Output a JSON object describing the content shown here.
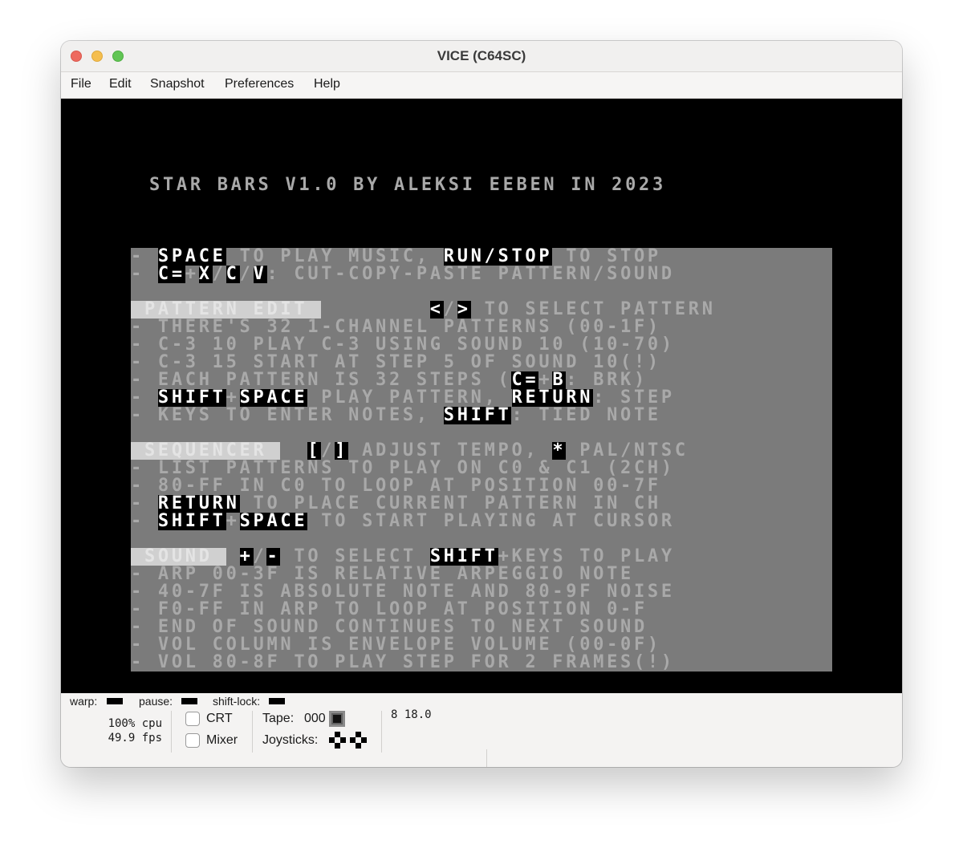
{
  "window": {
    "title": "VICE (C64SC)",
    "traffic_lights": [
      "close",
      "minimize",
      "zoom"
    ]
  },
  "menubar": {
    "items": [
      "File",
      "Edit",
      "Snapshot",
      "Preferences",
      "Help"
    ]
  },
  "c64_screen": {
    "title_line": "STAR BARS V1.0 BY ALEKSI EEBEN IN 2023",
    "lines": [
      [
        {
          "t": "- "
        },
        {
          "t": "SPACE",
          "s": "rv"
        },
        {
          "t": " TO PLAY MUSIC, "
        },
        {
          "t": "RUN/STOP",
          "s": "rv"
        },
        {
          "t": " TO STOP"
        }
      ],
      [
        {
          "t": "- "
        },
        {
          "t": "C=",
          "s": "rv"
        },
        {
          "t": "+"
        },
        {
          "t": "X",
          "s": "rv"
        },
        {
          "t": "/"
        },
        {
          "t": "C",
          "s": "rv"
        },
        {
          "t": "/"
        },
        {
          "t": "V",
          "s": "rv"
        },
        {
          "t": ": CUT-COPY-PASTE PATTERN/SOUND"
        }
      ],
      [
        {
          "t": ""
        }
      ],
      [
        {
          "t": " PATTERN EDIT ",
          "s": "hl"
        },
        {
          "t": "        "
        },
        {
          "t": "<",
          "s": "rv"
        },
        {
          "t": "/"
        },
        {
          "t": ">",
          "s": "rv"
        },
        {
          "t": " TO SELECT PATTERN"
        }
      ],
      [
        {
          "t": "- THERE'S 32 1-CHANNEL PATTERNS (00-1F)"
        }
      ],
      [
        {
          "t": "- C-3 10 PLAY C-3 USING SOUND 10 (10-70)"
        }
      ],
      [
        {
          "t": "- C-3 15 START AT STEP 5 OF SOUND 10(!)"
        }
      ],
      [
        {
          "t": "- EACH PATTERN IS 32 STEPS ("
        },
        {
          "t": "C=",
          "s": "rv"
        },
        {
          "t": "+"
        },
        {
          "t": "B",
          "s": "rv"
        },
        {
          "t": ": BRK)"
        }
      ],
      [
        {
          "t": "- "
        },
        {
          "t": "SHIFT",
          "s": "rv"
        },
        {
          "t": "+"
        },
        {
          "t": "SPACE",
          "s": "rv"
        },
        {
          "t": " PLAY PATTERN, "
        },
        {
          "t": "RETURN",
          "s": "rv"
        },
        {
          "t": ": STEP"
        }
      ],
      [
        {
          "t": "- KEYS TO ENTER NOTES, "
        },
        {
          "t": "SHIFT",
          "s": "rv"
        },
        {
          "t": ": TIED NOTE"
        }
      ],
      [
        {
          "t": ""
        }
      ],
      [
        {
          "t": " SEQUENCER ",
          "s": "hl"
        },
        {
          "t": "  "
        },
        {
          "t": "[",
          "s": "rv"
        },
        {
          "t": "/"
        },
        {
          "t": "]",
          "s": "rv"
        },
        {
          "t": " ADJUST TEMPO, "
        },
        {
          "t": "*",
          "s": "rv"
        },
        {
          "t": " PAL/NTSC"
        }
      ],
      [
        {
          "t": "- LIST PATTERNS TO PLAY ON C0 & C1 (2CH)"
        }
      ],
      [
        {
          "t": "- 80-FF IN C0 TO LOOP AT POSITION 00-7F"
        }
      ],
      [
        {
          "t": "- "
        },
        {
          "t": "RETURN",
          "s": "rv"
        },
        {
          "t": " TO PLACE CURRENT PATTERN IN CH"
        }
      ],
      [
        {
          "t": "- "
        },
        {
          "t": "SHIFT",
          "s": "rv"
        },
        {
          "t": "+"
        },
        {
          "t": "SPACE",
          "s": "rv"
        },
        {
          "t": " TO START PLAYING AT CURSOR"
        }
      ],
      [
        {
          "t": ""
        }
      ],
      [
        {
          "t": " SOUND ",
          "s": "hl"
        },
        {
          "t": " "
        },
        {
          "t": "+",
          "s": "rv"
        },
        {
          "t": "/"
        },
        {
          "t": "-",
          "s": "rv"
        },
        {
          "t": " TO SELECT "
        },
        {
          "t": "SHIFT",
          "s": "rv"
        },
        {
          "t": "+KEYS TO PLAY"
        }
      ],
      [
        {
          "t": "- ARP 00-3F IS RELATIVE ARPEGGIO NOTE"
        }
      ],
      [
        {
          "t": "- 40-7F IS ABSOLUTE NOTE AND 80-9F NOISE"
        }
      ],
      [
        {
          "t": "- F0-FF IN ARP TO LOOP AT POSITION 0-F"
        }
      ],
      [
        {
          "t": "- END OF SOUND CONTINUES TO NEXT SOUND"
        }
      ],
      [
        {
          "t": "- VOL COLUMN IS ENVELOPE VOLUME (00-0F)"
        }
      ],
      [
        {
          "t": "- VOL 80-8F TO PLAY STEP FOR 2 FRAMES(!)"
        }
      ]
    ]
  },
  "statusbar": {
    "warp_label": "warp:",
    "pause_label": "pause:",
    "shiftlock_label": "shift-lock:",
    "cpu": "100% cpu",
    "fps": "49.9 fps",
    "crt_label": "CRT",
    "mixer_label": "Mixer",
    "tape_label": "Tape:",
    "tape_counter": "000",
    "joysticks_label": "Joysticks:",
    "drive_info": "8 18.0"
  }
}
